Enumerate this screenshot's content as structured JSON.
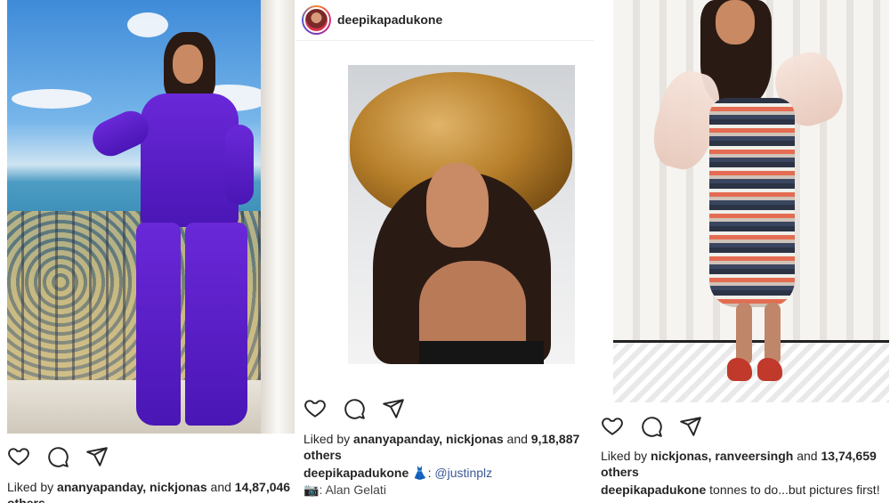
{
  "posts": [
    {
      "id": "left",
      "liked_prefix": "Liked by ",
      "liked_users": "ananyapanday, nickjonas",
      "liked_and": " and ",
      "liked_count": "14,87,046",
      "liked_overflow": "others"
    },
    {
      "id": "middle",
      "username": "deepikapadukone",
      "liked_prefix": "Liked by ",
      "liked_users": "ananyapanday, nickjonas",
      "liked_and": " and ",
      "liked_count": "9,18,887",
      "liked_others": "others",
      "caption_user": "deepikapadukone",
      "caption_emoji": "👗",
      "caption_sep": ": ",
      "caption_mention": "@justinplz",
      "credit_emoji": "📷",
      "credit_text": ": Alan Gelati"
    },
    {
      "id": "right",
      "liked_prefix": "Liked by ",
      "liked_users": "nickjonas, ranveersingh",
      "liked_and": " and ",
      "liked_count": "13,74,659",
      "liked_others": "others",
      "caption_user": "deepikapadukone",
      "caption_text": " tonnes to do...but pictures first!"
    }
  ],
  "icons": [
    "heart-icon",
    "comment-icon",
    "share-icon"
  ],
  "colors": {
    "suit": "#5a1fc9",
    "hat": "#b77f2a",
    "link": "#3b5998",
    "text": "#262626"
  }
}
